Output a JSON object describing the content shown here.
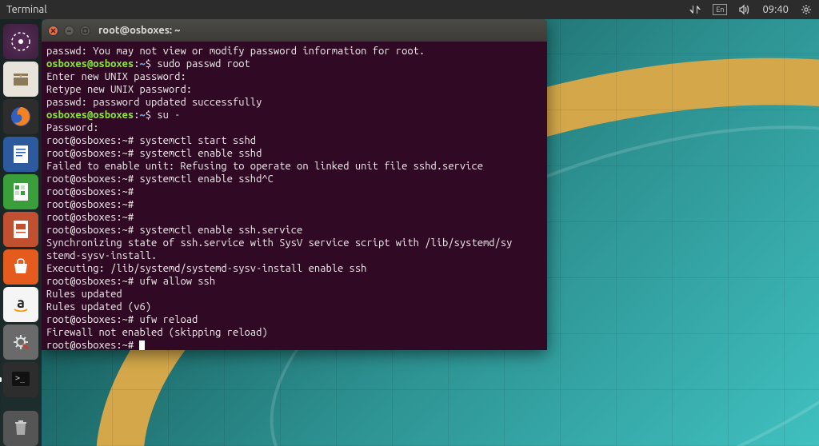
{
  "top_panel": {
    "app_name": "Terminal",
    "lang": "En",
    "time": "09:40"
  },
  "launcher": {
    "items": [
      {
        "name": "dash",
        "label": "Dash"
      },
      {
        "name": "files",
        "label": "Files"
      },
      {
        "name": "firefox",
        "label": "Firefox"
      },
      {
        "name": "writer",
        "label": "LibreOffice Writer"
      },
      {
        "name": "calc",
        "label": "LibreOffice Calc"
      },
      {
        "name": "impress",
        "label": "LibreOffice Impress"
      },
      {
        "name": "software",
        "label": "Ubuntu Software"
      },
      {
        "name": "amazon",
        "label": "Amazon"
      },
      {
        "name": "settings",
        "label": "System Settings"
      },
      {
        "name": "terminal",
        "label": "Terminal"
      }
    ],
    "trash": "Trash"
  },
  "terminal": {
    "title": "root@osboxes: ~",
    "lines": [
      {
        "segments": [
          {
            "t": "passwd: You may not view or modify password information for root.",
            "c": "w"
          }
        ]
      },
      {
        "segments": [
          {
            "t": "osboxes@osboxes",
            "c": "g"
          },
          {
            "t": ":",
            "c": "w"
          },
          {
            "t": "~",
            "c": "b"
          },
          {
            "t": "$ sudo passwd root",
            "c": "w"
          }
        ]
      },
      {
        "segments": [
          {
            "t": "Enter new UNIX password:",
            "c": "w"
          }
        ]
      },
      {
        "segments": [
          {
            "t": "Retype new UNIX password:",
            "c": "w"
          }
        ]
      },
      {
        "segments": [
          {
            "t": "passwd: password updated successfully",
            "c": "w"
          }
        ]
      },
      {
        "segments": [
          {
            "t": "osboxes@osboxes",
            "c": "g"
          },
          {
            "t": ":",
            "c": "w"
          },
          {
            "t": "~",
            "c": "b"
          },
          {
            "t": "$ su -",
            "c": "w"
          }
        ]
      },
      {
        "segments": [
          {
            "t": "Password:",
            "c": "w"
          }
        ]
      },
      {
        "segments": [
          {
            "t": "root@osboxes:~# systemctl start sshd",
            "c": "w"
          }
        ]
      },
      {
        "segments": [
          {
            "t": "root@osboxes:~# systemctl enable sshd",
            "c": "w"
          }
        ]
      },
      {
        "segments": [
          {
            "t": "Failed to enable unit: Refusing to operate on linked unit file sshd.service",
            "c": "w"
          }
        ]
      },
      {
        "segments": [
          {
            "t": "root@osboxes:~# systemctl enable sshd^C",
            "c": "w"
          }
        ]
      },
      {
        "segments": [
          {
            "t": "root@osboxes:~#",
            "c": "w"
          }
        ]
      },
      {
        "segments": [
          {
            "t": "root@osboxes:~#",
            "c": "w"
          }
        ]
      },
      {
        "segments": [
          {
            "t": "root@osboxes:~#",
            "c": "w"
          }
        ]
      },
      {
        "segments": [
          {
            "t": "root@osboxes:~# systemctl enable ssh.service",
            "c": "w"
          }
        ]
      },
      {
        "segments": [
          {
            "t": "Synchronizing state of ssh.service with SysV service script with /lib/systemd/sy",
            "c": "w"
          }
        ]
      },
      {
        "segments": [
          {
            "t": "stemd-sysv-install.",
            "c": "w"
          }
        ]
      },
      {
        "segments": [
          {
            "t": "Executing: /lib/systemd/systemd-sysv-install enable ssh",
            "c": "w"
          }
        ]
      },
      {
        "segments": [
          {
            "t": "root@osboxes:~# ufw allow ssh",
            "c": "w"
          }
        ]
      },
      {
        "segments": [
          {
            "t": "Rules updated",
            "c": "w"
          }
        ]
      },
      {
        "segments": [
          {
            "t": "Rules updated (v6)",
            "c": "w"
          }
        ]
      },
      {
        "segments": [
          {
            "t": "root@osboxes:~# ufw reload",
            "c": "w"
          }
        ]
      },
      {
        "segments": [
          {
            "t": "Firewall not enabled (skipping reload)",
            "c": "w"
          }
        ]
      },
      {
        "segments": [
          {
            "t": "root@osboxes:~# ",
            "c": "w"
          }
        ],
        "cursor": true
      }
    ]
  }
}
